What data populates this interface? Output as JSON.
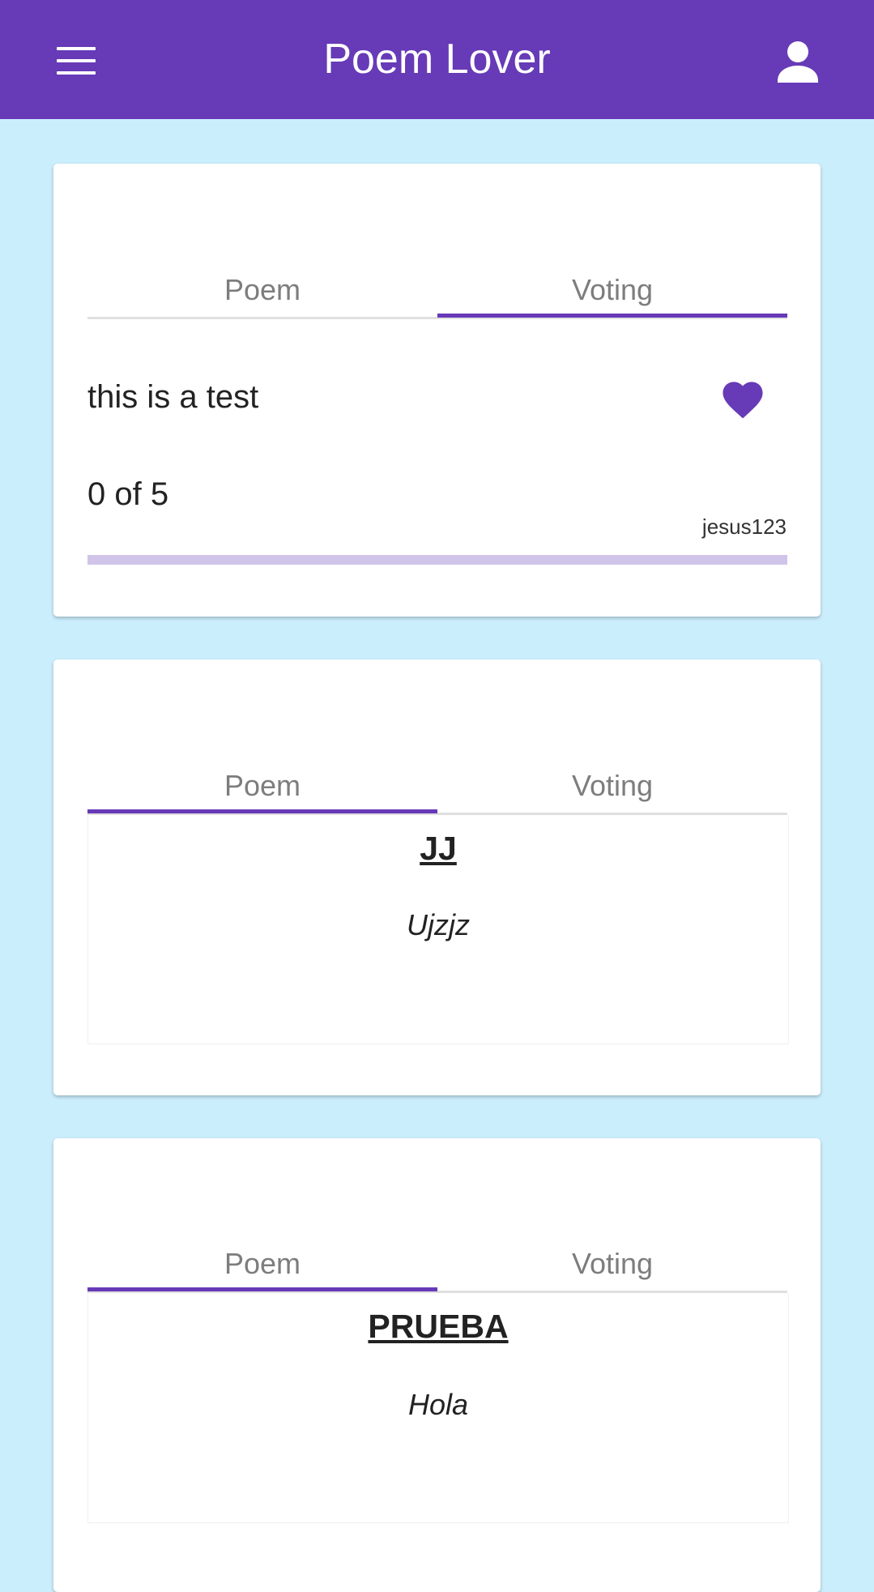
{
  "app": {
    "title": "Poem Lover"
  },
  "icons": {
    "menu": "menu-icon",
    "account": "account-icon",
    "heart": "heart-icon"
  },
  "colors": {
    "primary": "#673ab7",
    "background": "#cbeefd",
    "progress_track": "#d1c4e9",
    "tab_text": "#7d7d7d"
  },
  "cards": [
    {
      "tabs": [
        "Poem",
        "Voting"
      ],
      "active_tab": "Voting",
      "voting": {
        "text": "this is a test",
        "progress_label": "0 of 5",
        "progress_value": 0,
        "progress_max": 5,
        "author": "jesus123"
      }
    },
    {
      "tabs": [
        "Poem",
        "Voting"
      ],
      "active_tab": "Poem",
      "poem": {
        "title": "JJ",
        "body": "Ujzjz"
      }
    },
    {
      "tabs": [
        "Poem",
        "Voting"
      ],
      "active_tab": "Poem",
      "poem": {
        "title": "PRUEBA",
        "body": "Hola"
      }
    }
  ]
}
